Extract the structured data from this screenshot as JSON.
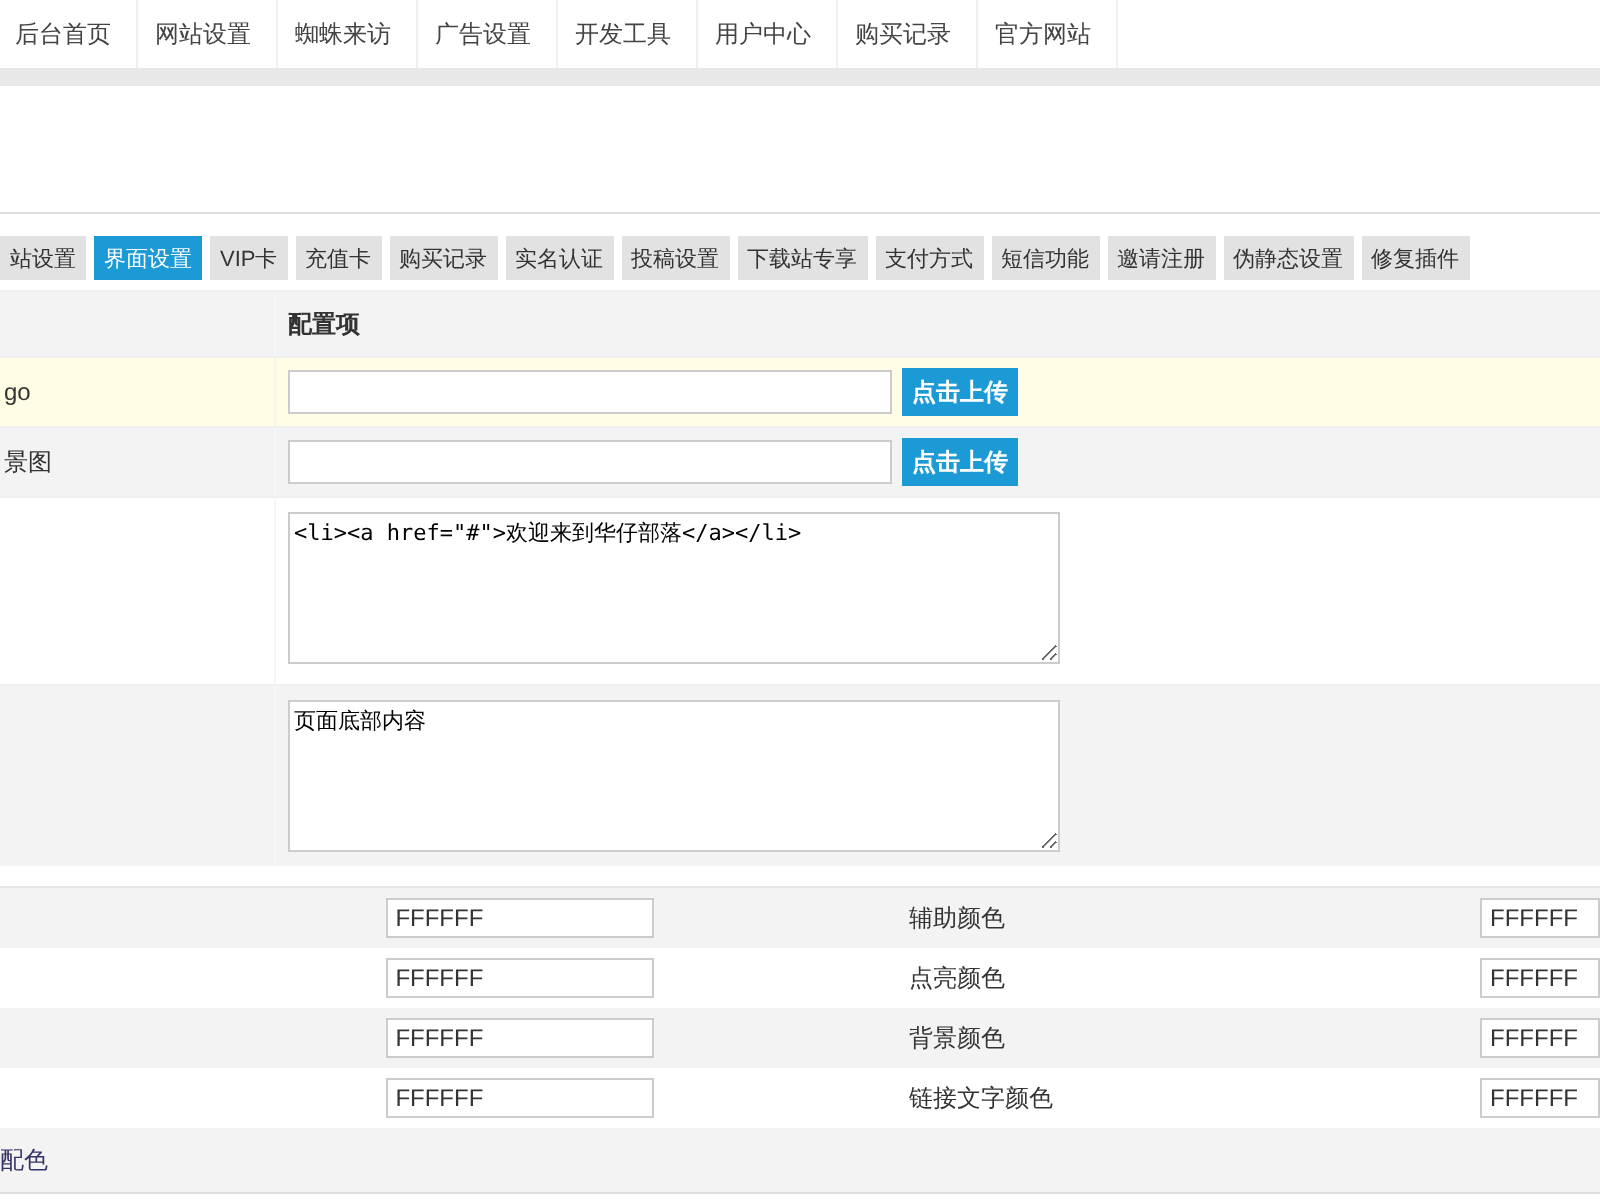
{
  "nav": {
    "items": [
      {
        "label": "后台首页"
      },
      {
        "label": "网站设置"
      },
      {
        "label": "蜘蛛来访"
      },
      {
        "label": "广告设置"
      },
      {
        "label": "开发工具"
      },
      {
        "label": "用户中心"
      },
      {
        "label": "购买记录"
      },
      {
        "label": "官方网站"
      }
    ]
  },
  "tabs": [
    {
      "label": "站设置",
      "selected": false
    },
    {
      "label": "界面设置",
      "selected": true
    },
    {
      "label": "VIP卡",
      "selected": false
    },
    {
      "label": "充值卡",
      "selected": false
    },
    {
      "label": "购买记录",
      "selected": false
    },
    {
      "label": "实名认证",
      "selected": false
    },
    {
      "label": "投稿设置",
      "selected": false
    },
    {
      "label": "下载站专享",
      "selected": false
    },
    {
      "label": "支付方式",
      "selected": false
    },
    {
      "label": "短信功能",
      "selected": false
    },
    {
      "label": "邀请注册",
      "selected": false
    },
    {
      "label": "伪静态设置",
      "selected": false
    },
    {
      "label": "修复插件",
      "selected": false
    }
  ],
  "table": {
    "columns": [
      {
        "label": "配置项"
      }
    ],
    "rows": [
      {
        "kind": "upload",
        "label": "go",
        "highlighted": true,
        "button": "点击上传"
      },
      {
        "kind": "upload",
        "label": "景图",
        "highlighted": false,
        "button": "点击上传"
      },
      {
        "kind": "textarea",
        "value": "<li><a href=\"#\">欢迎来到华仔部落</a></li>",
        "highlighted": false
      },
      {
        "kind": "textarea",
        "value": "页面底部内容",
        "highlighted": false
      }
    ]
  },
  "color_rows": [
    {
      "value_1": "FFFFFF",
      "label_2": "辅助颜色",
      "value_2": "FFFFFF"
    },
    {
      "value_1": "FFFFFF",
      "label_2": "点亮颜色",
      "value_2": "FFFFFF"
    },
    {
      "value_1": "FFFFFF",
      "label_2": "背景颜色",
      "value_2": "FFFFFF"
    },
    {
      "value_1": "FFFFFF",
      "label_2": "链接文字颜色",
      "value_2": "FFFFFF"
    }
  ],
  "footer_link": "配色"
}
